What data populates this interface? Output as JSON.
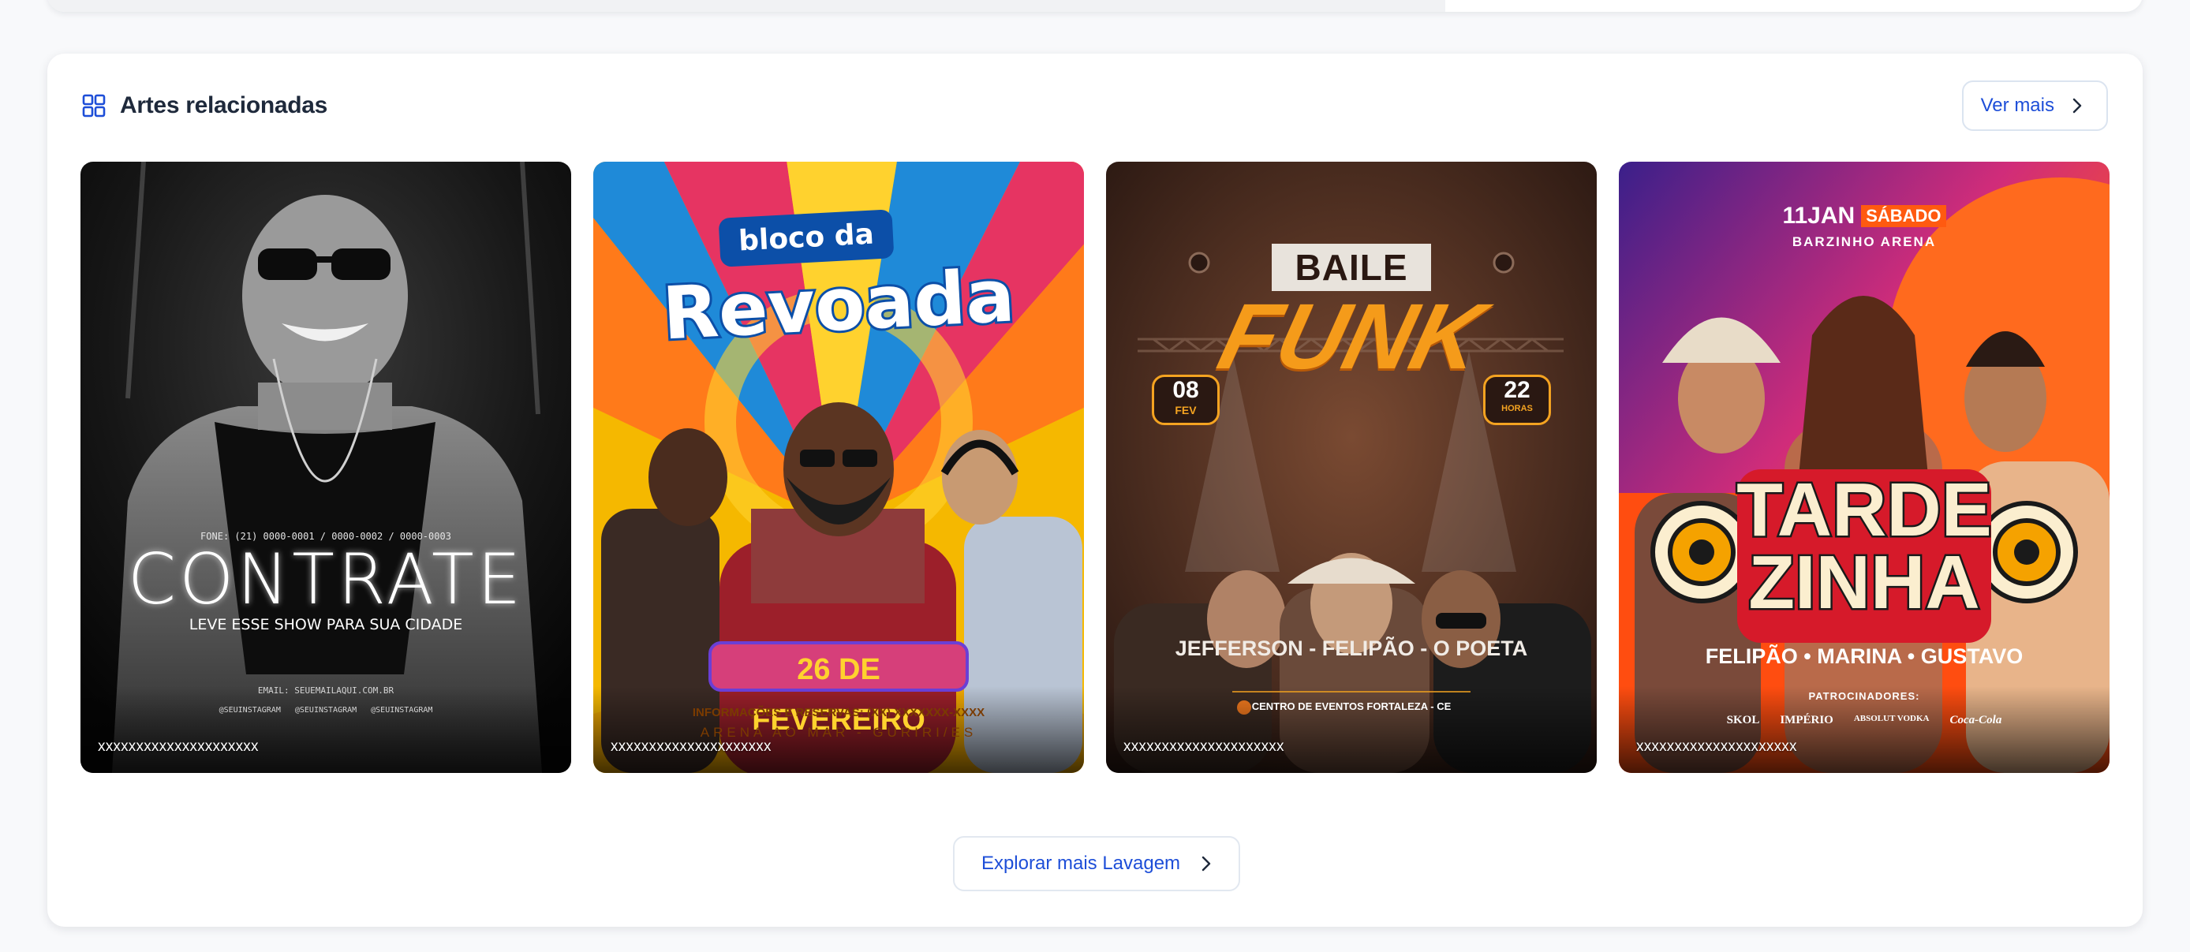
{
  "section": {
    "title": "Artes relacionadas",
    "see_more_label": "Ver mais",
    "icon": "grid-icon"
  },
  "cards": [
    {
      "caption": "xxxxxxxxxxxxxxxxxxxxx",
      "poster": {
        "phone": "FONE: (21) 0000-0001 / 0000-0002 / 0000-0003",
        "headline": "CONTRATE",
        "tagline": "LEVE ESSE SHOW PARA SUA CIDADE",
        "email": "EMAIL: SEUEMAILAQUI.COM.BR",
        "socials": [
          "@SEUINSTAGRAM",
          "@SEUINSTAGRAM",
          "@SEUINSTAGRAM"
        ]
      }
    },
    {
      "caption": "xxxxxxxxxxxxxxxxxxxxx",
      "poster": {
        "top": "bloco da",
        "headline": "Revoada",
        "date": "26 DE FEVEREIRO",
        "info": "INFORMAÇÕES E RESERVAS: (XX) XXXXXXX-XXXX",
        "venue": "ARENA AO MAR - GURIRI/ES"
      }
    },
    {
      "caption": "xxxxxxxxxxxxxxxxxxxxx",
      "poster": {
        "top": "BAILE",
        "headline": "FUNK",
        "day": "08",
        "month": "FEV",
        "hour": "22",
        "hour_label": "HORAS",
        "artists": "JEFFERSON -  FELIPÃO -  O POETA",
        "venue": "CENTRO DE EVENTOS FORTALEZA - CE"
      }
    },
    {
      "caption": "xxxxxxxxxxxxxxxxxxxxx",
      "poster": {
        "date": "11JAN",
        "weekday": "SÁBADO",
        "venue": "BARZINHO ARENA",
        "headline_1": "TARDE",
        "headline_2": "ZINHA",
        "artists": "FELIPÃO • MARINA • GUSTAVO",
        "sponsors_label": "PATROCINADORES:",
        "sponsors": [
          "SKOL",
          "IMPÉRIO",
          "ABSOLUT VODKA",
          "Coca-Cola"
        ]
      }
    }
  ],
  "explore_label": "Explorar mais Lavagem",
  "colors": {
    "accent": "#1d4ed8",
    "title": "#1e293b",
    "border": "#dbe4f0",
    "card_bg": "#ffffff"
  }
}
